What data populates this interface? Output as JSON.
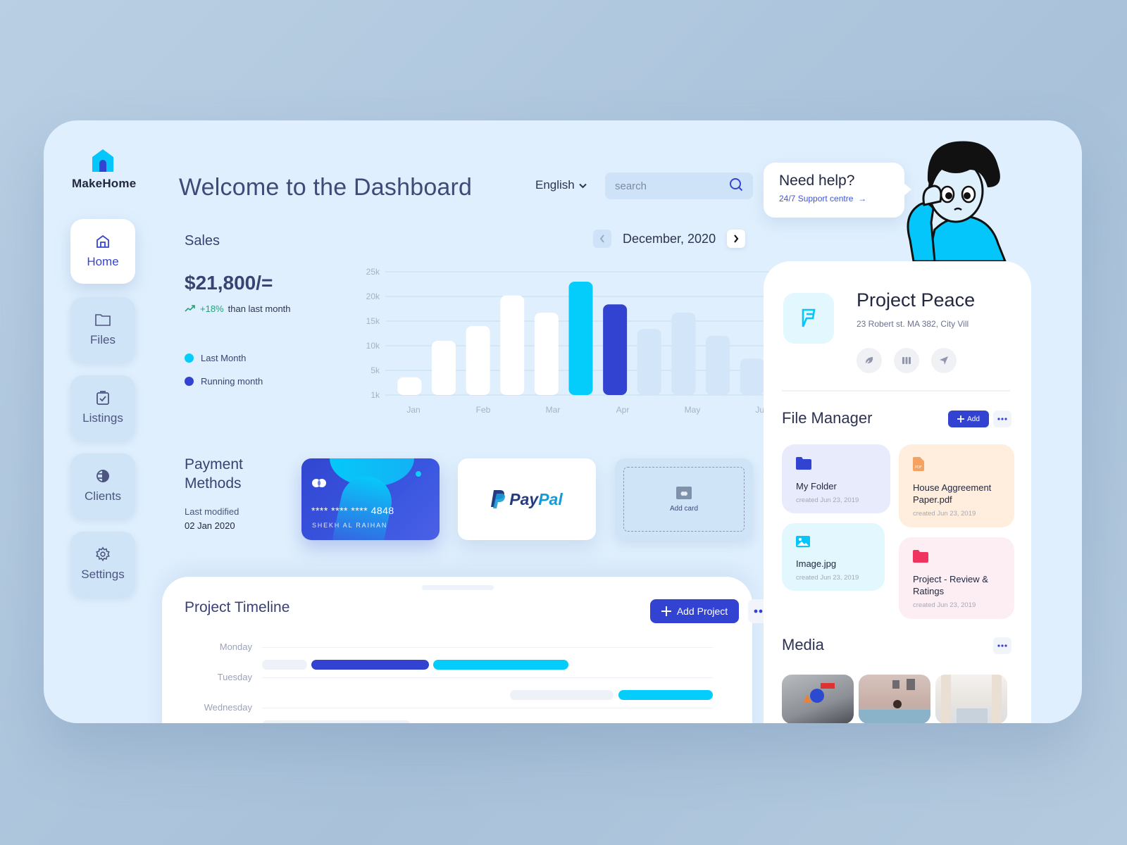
{
  "app": {
    "name": "MakeHome"
  },
  "sidebar": {
    "items": [
      {
        "label": "Home",
        "icon": "home-icon",
        "active": true
      },
      {
        "label": "Files",
        "icon": "folder-icon",
        "active": false
      },
      {
        "label": "Listings",
        "icon": "clipboard-check-icon",
        "active": false
      },
      {
        "label": "Clients",
        "icon": "globe-icon",
        "active": false
      },
      {
        "label": "Settings",
        "icon": "gear-icon",
        "active": false
      }
    ]
  },
  "header": {
    "title": "Welcome to the Dashboard",
    "language": "English",
    "search_placeholder": "search"
  },
  "sales": {
    "title": "Sales",
    "amount": "$21,800/=",
    "delta_pct": "+18%",
    "delta_text": "than last month",
    "legend": [
      {
        "label": "Last Month",
        "color": "#05cdfb"
      },
      {
        "label": "Running month",
        "color": "#3343d1"
      }
    ],
    "period": "December, 2020"
  },
  "chart_data": {
    "type": "bar",
    "title": "Sales",
    "xlabel": "",
    "ylabel": "",
    "ylim": [
      0,
      25000
    ],
    "yticks": [
      "1k",
      "5k",
      "10k",
      "15k",
      "20k",
      "25k"
    ],
    "ytick_values": [
      0,
      5000,
      10000,
      15000,
      20000,
      25000
    ],
    "xticks": [
      "Jan",
      "Feb",
      "Mar",
      "Apr",
      "May",
      "Jun"
    ],
    "grid": true,
    "values": [
      3600,
      11000,
      14000,
      20200,
      16700,
      23000,
      18400,
      13400,
      16700,
      12000,
      7400
    ],
    "bar_styles": [
      "past",
      "past",
      "past",
      "past",
      "past",
      "last",
      "running",
      "future",
      "future",
      "future",
      "future"
    ],
    "colors": {
      "past": "#ffffff",
      "last": "#05cdfb",
      "running": "#3343d1",
      "future": "#d2e5f9"
    }
  },
  "payment": {
    "title": "Payment Methods",
    "last_modified_label": "Last modified",
    "last_modified_date": "02 Jan 2020",
    "card": {
      "masked": "**** **** ****",
      "last4": "4848",
      "holder": "SHEKH AL RAIHAN"
    },
    "paypal": {
      "pay": "Pay",
      "pal": "Pal"
    },
    "add_card_label": "Add card"
  },
  "timeline": {
    "title": "Project Timeline",
    "add_label": "Add Project",
    "days": [
      "Monday",
      "Tuesday",
      "Wednesday"
    ],
    "bars": [
      {
        "day": 0,
        "start": 0.0,
        "end": 0.1,
        "color": "#eef2f8"
      },
      {
        "day": 0,
        "start": 0.11,
        "end": 0.37,
        "color": "#3343d1"
      },
      {
        "day": 0,
        "start": 0.38,
        "end": 0.68,
        "color": "#05cdfb"
      },
      {
        "day": 1,
        "start": 0.55,
        "end": 0.78,
        "color": "#eef2f8"
      },
      {
        "day": 1,
        "start": 0.79,
        "end": 1.0,
        "color": "#05cdfb"
      },
      {
        "day": 2,
        "start": 0.0,
        "end": 0.33,
        "color": "#eef2f8"
      }
    ]
  },
  "help": {
    "title": "Need help?",
    "link": "24/7 Support centre"
  },
  "project": {
    "name": "Project Peace",
    "address": "23 Robert st. MA 382, City Vill",
    "actions": [
      "leaf-icon",
      "columns-icon",
      "send-icon"
    ]
  },
  "file_manager": {
    "title": "File Manager",
    "add_label": "Add",
    "files": [
      {
        "name": "My Folder",
        "created": "created Jun 23, 2019",
        "type": "folder",
        "bg": "#e8ebfb",
        "icon_color": "#3343d1"
      },
      {
        "name": "House Aggreement Paper.pdf",
        "created": "created Jun 23, 2019",
        "type": "pdf",
        "bg": "#ffeedd",
        "icon_color": "#f3a261"
      },
      {
        "name": "Image.jpg",
        "created": "created Jun 23, 2019",
        "type": "image",
        "bg": "#e3f7fe",
        "icon_color": "#05cdfb"
      },
      {
        "name": "Project - Review & Ratings",
        "created": "created Jun 23, 2019",
        "type": "folder",
        "bg": "#fdeef3",
        "icon_color": "#ef3460"
      }
    ]
  },
  "media": {
    "title": "Media",
    "items": [
      "toys-photo",
      "living-room-photo",
      "bedroom-photo"
    ]
  }
}
